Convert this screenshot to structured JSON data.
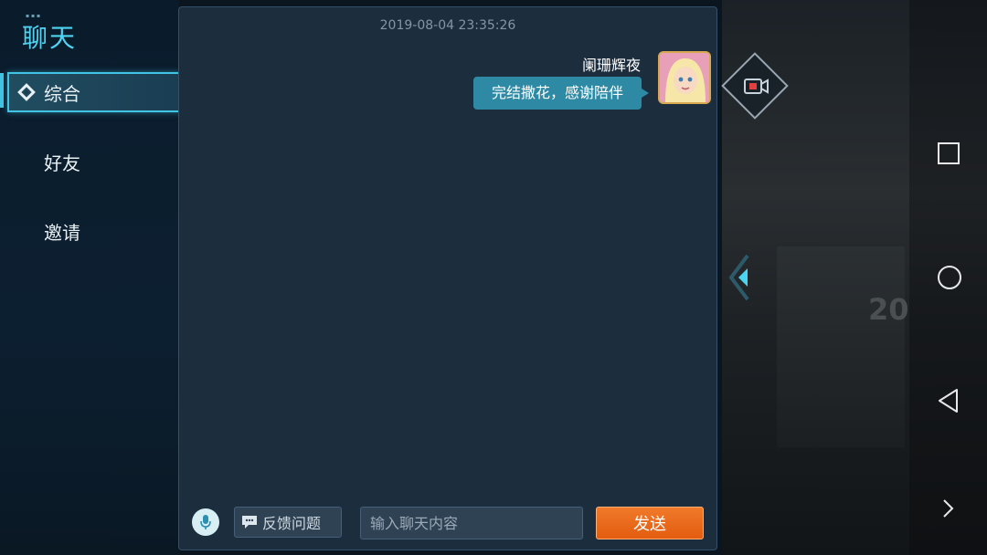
{
  "sidebar": {
    "title": "聊天",
    "items": [
      {
        "label": "综合",
        "active": true
      },
      {
        "label": "好友",
        "active": false
      },
      {
        "label": "邀请",
        "active": false
      }
    ]
  },
  "chat": {
    "timestamp": "2019-08-04 23:35:26",
    "message": {
      "sender": "阑珊辉夜",
      "text": "完结撒花，感谢陪伴"
    },
    "footer": {
      "feedback_label": "反馈问题",
      "input_placeholder": "输入聊天内容",
      "send_label": "发送"
    }
  },
  "scene": {
    "building_text": "20"
  },
  "colors": {
    "accent": "#41c4e3",
    "bubble": "#2e8aa4",
    "send": "#e35c10"
  }
}
